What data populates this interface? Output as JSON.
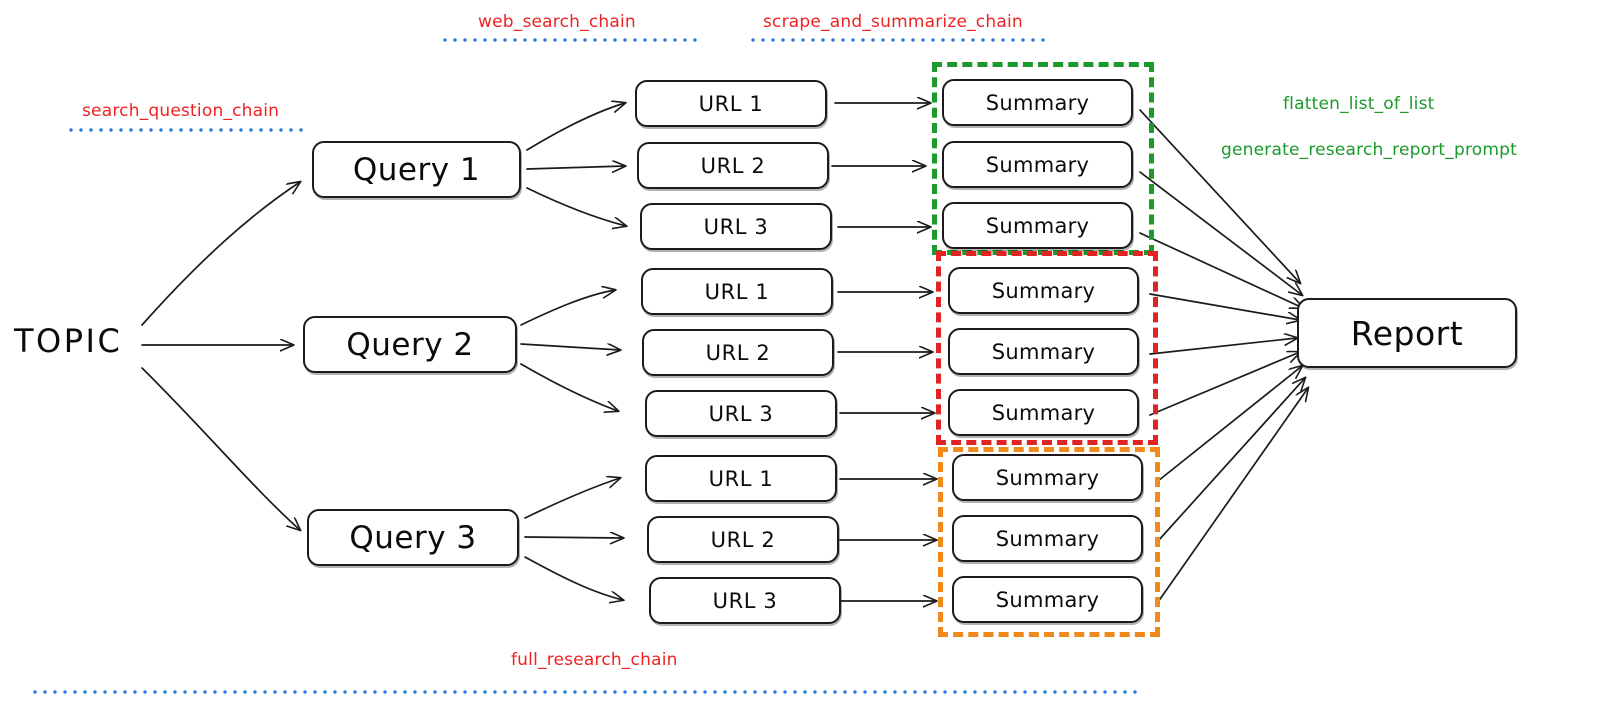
{
  "diagram": {
    "title": "LangChain research assistant chain diagram",
    "background": "#ffffff",
    "nodes": {
      "topic": {
        "label": "TOPIC"
      },
      "report": {
        "label": "Report"
      },
      "queries": [
        {
          "label": "Query 1"
        },
        {
          "label": "Query 2"
        },
        {
          "label": "Query 3"
        }
      ],
      "urls": [
        {
          "label": "URL 1"
        },
        {
          "label": "URL 2"
        },
        {
          "label": "URL 3"
        }
      ],
      "summary_label": "Summary"
    },
    "groups": [
      {
        "name": "query-1-summaries",
        "color": "#1a9a2a"
      },
      {
        "name": "query-2-summaries",
        "color": "#e02424"
      },
      {
        "name": "query-3-summaries",
        "color": "#f08a1a"
      }
    ],
    "chain_labels": {
      "search_question_chain": "search_question_chain",
      "web_search_chain": "web_search_chain",
      "scrape_and_summarize_chain": "scrape_and_summarize_chain",
      "full_research_chain": "full_research_chain",
      "flatten_list_of_list": "flatten_list_of_list",
      "generate_research_report_prompt": "generate_research_report_prompt"
    },
    "colors": {
      "red_label": "#ee2222",
      "green_label": "#1a9a2a",
      "blue_rule": "#2277dd",
      "group_green": "#1a9a2a",
      "group_red": "#e02424",
      "group_orange": "#f08a1a",
      "stroke": "#1b1b1b"
    }
  }
}
